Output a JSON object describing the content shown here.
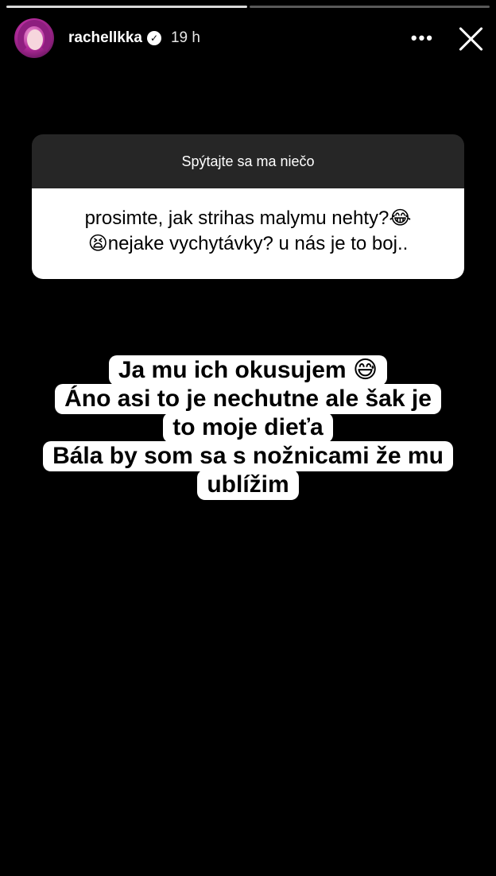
{
  "progress": {
    "segments_total": 2,
    "current_index": 0
  },
  "header": {
    "avatar_icon": "profile-avatar",
    "username": "rachellkka",
    "verified": true,
    "verified_icon": "verified-badge-icon",
    "time": "19 h",
    "more_label": "•••",
    "close_icon": "close-icon"
  },
  "question": {
    "title": "Spýtajte sa ma niečo",
    "line1": "prosimte, jak strihas malymu nehty?😂",
    "line2": "😫nejake vychytávky? u nás je to boj.."
  },
  "answer": {
    "lines": [
      "Ja mu ich okusujem 😅",
      "Áno asi to je nechutne ale šak je",
      "to moje dieťa",
      "Bála by som sa s nožnicami že mu",
      "ublížim"
    ]
  },
  "colors": {
    "background": "#000000",
    "question_header": "#262626",
    "card": "#ffffff"
  }
}
